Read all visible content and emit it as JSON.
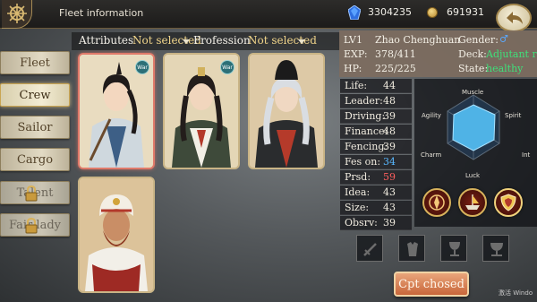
{
  "header": {
    "title": "Fleet information",
    "gems": "3304235",
    "gold": "691931"
  },
  "menu": [
    {
      "label": "Fleet",
      "state": "normal"
    },
    {
      "label": "Crew",
      "state": "active"
    },
    {
      "label": "Sailor",
      "state": "normal"
    },
    {
      "label": "Cargo",
      "state": "normal"
    },
    {
      "label": "Talent",
      "state": "locked"
    },
    {
      "label": "Fair lady",
      "state": "locked"
    }
  ],
  "filter": {
    "attributes_label": "Attributes",
    "attributes_value": "Not selected",
    "profession_label": "Profession",
    "profession_value": "Not selected"
  },
  "cards": [
    {
      "badge": "War",
      "selected": true
    },
    {
      "badge": "War",
      "selected": false
    },
    {
      "badge": "",
      "selected": false
    },
    {
      "badge": "",
      "selected": false
    }
  ],
  "character": {
    "level": "LV1",
    "name": "Zhao Chenghuan",
    "gender_label": "Gender:",
    "gender_symbol": "♂",
    "exp_label": "EXP:",
    "exp": "378/411",
    "deck_label": "Deck:",
    "deck": "Adjutant ro",
    "hp_label": "HP:",
    "hp": "225/225",
    "state_label": "State:",
    "state": "healthy"
  },
  "stats": [
    {
      "label": "Life:",
      "value": "44",
      "color": "normal"
    },
    {
      "label": "Leader:",
      "value": "48",
      "color": "normal"
    },
    {
      "label": "Driving:",
      "value": "39",
      "color": "normal"
    },
    {
      "label": "Finance:",
      "value": "48",
      "color": "normal"
    },
    {
      "label": "Fencing:",
      "value": "39",
      "color": "normal"
    },
    {
      "label": "Fes on:",
      "value": "34",
      "color": "blue"
    },
    {
      "label": "Prsd:",
      "value": "59",
      "color": "red"
    },
    {
      "label": "Idea:",
      "value": "43",
      "color": "normal"
    },
    {
      "label": "Size:",
      "value": "43",
      "color": "normal"
    },
    {
      "label": "Obsrv:",
      "value": "39",
      "color": "normal"
    }
  ],
  "radar": {
    "labels": [
      "Muscle",
      "Spirit",
      "Int",
      "Luck",
      "Charm",
      "Agility"
    ]
  },
  "actions": {
    "captain_button": "Cpt chosed"
  },
  "watermark": "激活 Windo"
}
